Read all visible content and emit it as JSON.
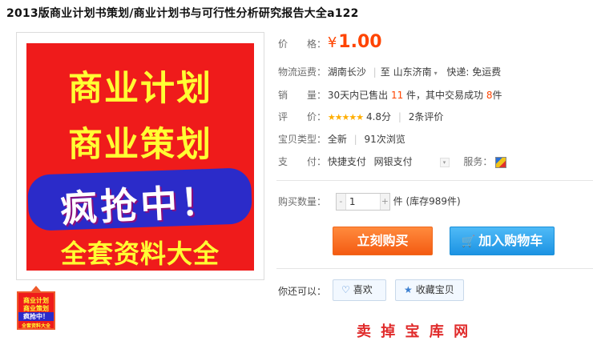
{
  "title": "2013版商业计划书策划/商业计划书与可行性分析研究报告大全a122",
  "poster": {
    "line1": "商业计划",
    "line2": "商业策划",
    "line3": "疯抢中！",
    "line4": "全套资料大全"
  },
  "thumb": {
    "line1": "商业计划",
    "line2": "商业策划",
    "line3": "疯抢中！",
    "line4": "全套资料大全"
  },
  "price": {
    "label": "价　　格：",
    "symbol": "¥",
    "value": "1.00"
  },
  "shipping": {
    "label": "物流运费：",
    "from": "湖南长沙",
    "sep": "|",
    "to_prefix": "至",
    "to": "山东济南",
    "caret": "▾",
    "fee": "快递: 免运费"
  },
  "sales": {
    "label": "销　　量：",
    "prefix": "30天内已售出",
    "sold": "11",
    "mid": "件，其中交易成功",
    "success": "8",
    "suffix": "件"
  },
  "rating": {
    "label": "评　　价：",
    "stars": "★★★★★",
    "score": "4.8分",
    "sep": "|",
    "reviews": "2条评价"
  },
  "item_type": {
    "label": "宝贝类型：",
    "condition": "全新",
    "sep": "|",
    "views": "91次浏览"
  },
  "payment": {
    "label": "支　　付：",
    "method1": "快捷支付",
    "method2": "网银支付",
    "select_glyph": "▾",
    "service_label": "服务："
  },
  "quantity": {
    "label": "购买数量：",
    "minus": "-",
    "value": "1",
    "plus": "+",
    "stock": "件 (库存989件)"
  },
  "buttons": {
    "buy_now": "立刻购买",
    "add_cart": "加入购物车"
  },
  "extras": {
    "label": "你还可以：",
    "like": "喜欢",
    "favorite": "收藏宝贝"
  },
  "peek_text": "卖 掉 宝 库 网"
}
